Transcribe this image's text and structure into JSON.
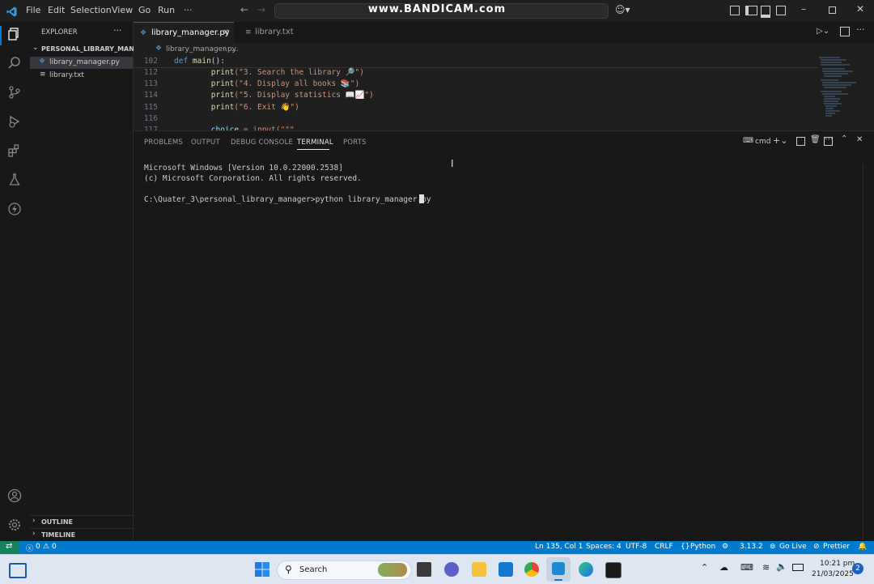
{
  "menu": [
    "File",
    "Edit",
    "Selection",
    "View",
    "Go",
    "Run",
    "···"
  ],
  "watermark": "www.BANDICAM.com",
  "explorer": {
    "title": "EXPLORER",
    "folder": "PERSONAL_LIBRARY_MAN...",
    "files": [
      "library_manager.py",
      "library.txt"
    ],
    "outline": "OUTLINE",
    "timeline": "TIMELINE"
  },
  "tabs": [
    {
      "label": "library_manager.py",
      "active": true
    },
    {
      "label": "library.txt",
      "active": false
    }
  ],
  "breadcrumb": {
    "file": "library_manager.py",
    "rest": "..."
  },
  "code": {
    "sticky": {
      "num": "102",
      "text": "def main():"
    },
    "lines": [
      {
        "num": "112",
        "text": "        print(\"3. Search the library 🔎\")"
      },
      {
        "num": "113",
        "text": "        print(\"4. Display all books 📚\")"
      },
      {
        "num": "114",
        "text": "        print(\"5. Display statistics 📖📈\")"
      },
      {
        "num": "115",
        "text": "        print(\"6. Exit 👋\")"
      },
      {
        "num": "116",
        "text": ""
      },
      {
        "num": "117",
        "text": "        choice = input(\"\"\""
      }
    ]
  },
  "panel": {
    "tabs": [
      "PROBLEMS",
      "OUTPUT",
      "DEBUG CONSOLE",
      "TERMINAL",
      "PORTS"
    ],
    "active_tab": "TERMINAL",
    "shell": "cmd",
    "terminal_lines": [
      "Microsoft Windows [Version 10.0.22000.2538]",
      "(c) Microsoft Corporation. All rights reserved.",
      "",
      "C:\\Quater_3\\personal_library_manager>python library_manager.py"
    ]
  },
  "status": {
    "errors": "0",
    "warnings": "0",
    "position": "Ln 135, Col 1",
    "spaces": "Spaces: 4",
    "encoding": "UTF-8",
    "eol": "CRLF",
    "language": "Python",
    "version": "3.13.2",
    "golive": "Go Live",
    "prettier": "Prettier"
  },
  "taskbar": {
    "search": "Search",
    "time": "10:21 pm",
    "date": "21/03/2025",
    "notifications": "2"
  },
  "colors": {
    "accent": "#007acc",
    "keyword": "#569cd6",
    "function": "#dcdcaa",
    "string": "#ce9178"
  }
}
